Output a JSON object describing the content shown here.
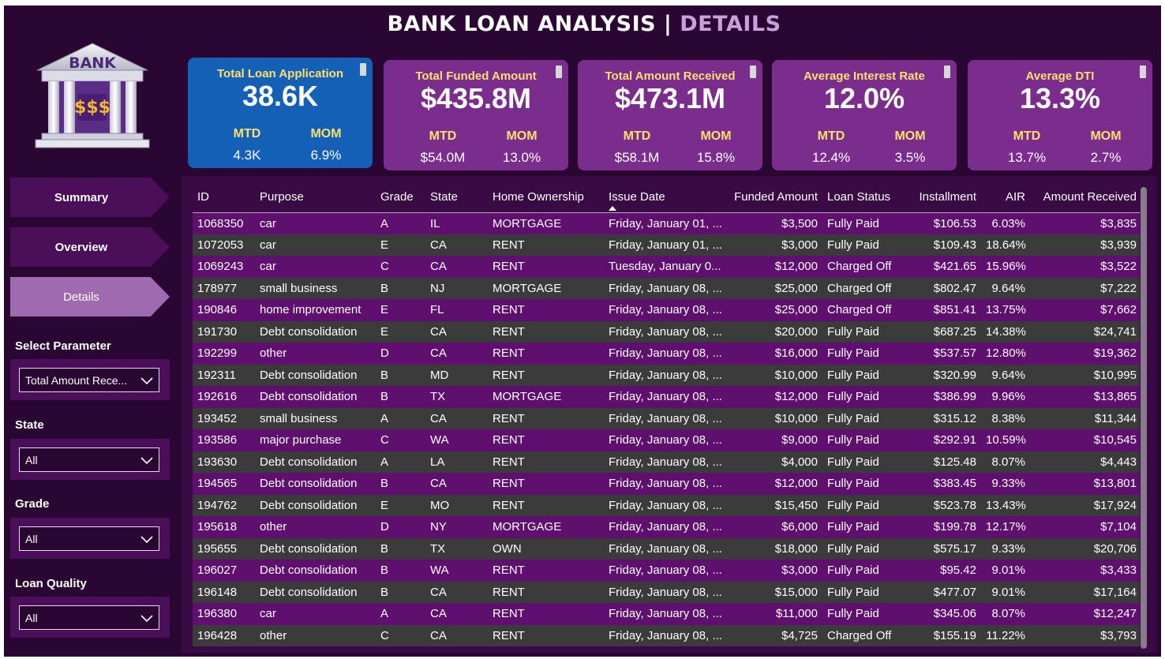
{
  "header": {
    "title_main": "BANK LOAN ANALYSIS",
    "title_sep": "|",
    "title_accent": "DETAILS"
  },
  "logo": {
    "text": "BANK",
    "symbol": "$$$"
  },
  "nav": {
    "items": [
      {
        "label": "Summary",
        "active": false
      },
      {
        "label": "Overview",
        "active": false
      },
      {
        "label": "Details",
        "active": true
      }
    ]
  },
  "filters": {
    "parameter": {
      "label": "Select Parameter",
      "value": "Total Amount Rece..."
    },
    "state": {
      "label": "State",
      "value": "All"
    },
    "grade": {
      "label": "Grade",
      "value": "All"
    },
    "loan_quality": {
      "label": "Loan Quality",
      "value": "All"
    }
  },
  "kpis": [
    {
      "title": "Total Loan Application",
      "value": "38.6K",
      "mtd_label": "MTD",
      "mtd": "4.3K",
      "mom_label": "MOM",
      "mom": "6.9%"
    },
    {
      "title": "Total Funded Amount",
      "value": "$435.8M",
      "mtd_label": "MTD",
      "mtd": "$54.0M",
      "mom_label": "MOM",
      "mom": "13.0%"
    },
    {
      "title": "Total Amount Received",
      "value": "$473.1M",
      "mtd_label": "MTD",
      "mtd": "$58.1M",
      "mom_label": "MOM",
      "mom": "15.8%"
    },
    {
      "title": "Average Interest Rate",
      "value": "12.0%",
      "mtd_label": "MTD",
      "mtd": "12.4%",
      "mom_label": "MOM",
      "mom": "3.5%"
    },
    {
      "title": "Average DTI",
      "value": "13.3%",
      "mtd_label": "MTD",
      "mtd": "13.7%",
      "mom_label": "MOM",
      "mom": "2.7%"
    }
  ],
  "table": {
    "columns": [
      "ID",
      "Purpose",
      "Grade",
      "State",
      "Home Ownership",
      "Issue Date",
      "Funded Amount",
      "Loan Status",
      "Installment",
      "AIR",
      "Amount Received"
    ],
    "rows": [
      [
        "1068350",
        "car",
        "A",
        "IL",
        "MORTGAGE",
        "Friday, January 01, ...",
        "$3,500",
        "Fully Paid",
        "$106.53",
        "6.03%",
        "$3,835"
      ],
      [
        "1072053",
        "car",
        "E",
        "CA",
        "RENT",
        "Friday, January 01, ...",
        "$3,000",
        "Fully Paid",
        "$109.43",
        "18.64%",
        "$3,939"
      ],
      [
        "1069243",
        "car",
        "C",
        "CA",
        "RENT",
        "Tuesday, January 0...",
        "$12,000",
        "Charged Off",
        "$421.65",
        "15.96%",
        "$3,522"
      ],
      [
        "178977",
        "small business",
        "B",
        "NJ",
        "MORTGAGE",
        "Friday, January 08, ...",
        "$25,000",
        "Charged Off",
        "$802.47",
        "9.64%",
        "$7,222"
      ],
      [
        "190846",
        "home improvement",
        "E",
        "FL",
        "RENT",
        "Friday, January 08, ...",
        "$25,000",
        "Charged Off",
        "$851.41",
        "13.75%",
        "$7,662"
      ],
      [
        "191730",
        "Debt consolidation",
        "E",
        "CA",
        "RENT",
        "Friday, January 08, ...",
        "$20,000",
        "Fully Paid",
        "$687.25",
        "14.38%",
        "$24,741"
      ],
      [
        "192299",
        "other",
        "D",
        "CA",
        "RENT",
        "Friday, January 08, ...",
        "$16,000",
        "Fully Paid",
        "$537.57",
        "12.80%",
        "$19,362"
      ],
      [
        "192311",
        "Debt consolidation",
        "B",
        "MD",
        "RENT",
        "Friday, January 08, ...",
        "$10,000",
        "Fully Paid",
        "$320.99",
        "9.64%",
        "$10,995"
      ],
      [
        "192616",
        "Debt consolidation",
        "B",
        "TX",
        "MORTGAGE",
        "Friday, January 08, ...",
        "$12,000",
        "Fully Paid",
        "$386.99",
        "9.96%",
        "$13,865"
      ],
      [
        "193452",
        "small business",
        "A",
        "CA",
        "RENT",
        "Friday, January 08, ...",
        "$10,000",
        "Fully Paid",
        "$315.12",
        "8.38%",
        "$11,344"
      ],
      [
        "193586",
        "major purchase",
        "C",
        "WA",
        "RENT",
        "Friday, January 08, ...",
        "$9,000",
        "Fully Paid",
        "$292.91",
        "10.59%",
        "$10,545"
      ],
      [
        "193630",
        "Debt consolidation",
        "A",
        "LA",
        "RENT",
        "Friday, January 08, ...",
        "$4,000",
        "Fully Paid",
        "$125.48",
        "8.07%",
        "$4,443"
      ],
      [
        "194565",
        "Debt consolidation",
        "B",
        "CA",
        "RENT",
        "Friday, January 08, ...",
        "$12,000",
        "Fully Paid",
        "$383.45",
        "9.33%",
        "$13,801"
      ],
      [
        "194762",
        "Debt consolidation",
        "E",
        "MO",
        "RENT",
        "Friday, January 08, ...",
        "$15,450",
        "Fully Paid",
        "$523.78",
        "13.43%",
        "$17,924"
      ],
      [
        "195618",
        "other",
        "D",
        "NY",
        "MORTGAGE",
        "Friday, January 08, ...",
        "$6,000",
        "Fully Paid",
        "$199.78",
        "12.17%",
        "$7,104"
      ],
      [
        "195655",
        "Debt consolidation",
        "B",
        "TX",
        "OWN",
        "Friday, January 08, ...",
        "$18,000",
        "Fully Paid",
        "$575.17",
        "9.33%",
        "$20,706"
      ],
      [
        "196027",
        "Debt consolidation",
        "B",
        "WA",
        "RENT",
        "Friday, January 08, ...",
        "$3,000",
        "Fully Paid",
        "$95.42",
        "9.01%",
        "$3,433"
      ],
      [
        "196148",
        "Debt consolidation",
        "B",
        "CA",
        "RENT",
        "Friday, January 08, ...",
        "$15,000",
        "Fully Paid",
        "$477.07",
        "9.01%",
        "$17,164"
      ],
      [
        "196380",
        "car",
        "A",
        "CA",
        "RENT",
        "Friday, January 08, ...",
        "$11,000",
        "Fully Paid",
        "$345.06",
        "8.07%",
        "$12,247"
      ],
      [
        "196428",
        "other",
        "C",
        "CA",
        "RENT",
        "Friday, January 08, ...",
        "$4,725",
        "Charged Off",
        "$155.19",
        "11.22%",
        "$3,793"
      ]
    ]
  },
  "colors": {
    "background": "#2a0733",
    "panel": "#4b0f5a",
    "kpi_card": "#7b2d8e",
    "kpi_card_highlight": "#1560b7",
    "kpi_label": "#ffe06b",
    "row_odd": "#5f0f6e",
    "row_even": "#3b3b3b",
    "accent": "#c9a0dc"
  },
  "icons": {
    "dropdown": "chevron-down-icon",
    "logo": "bank-icon",
    "sort": "sort-ascending-icon"
  }
}
